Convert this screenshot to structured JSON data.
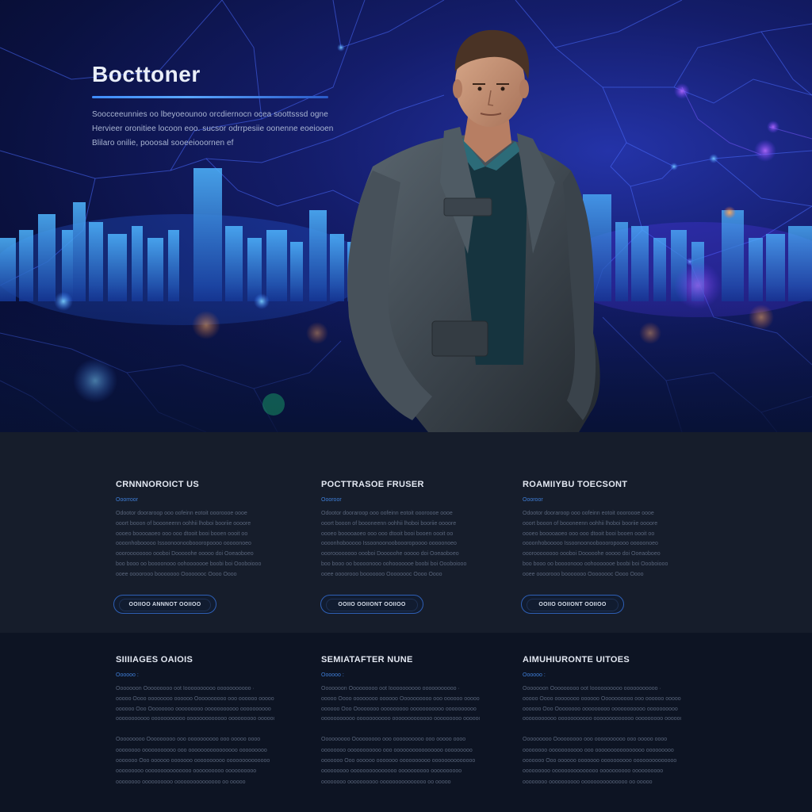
{
  "hero": {
    "title": "Bocttoner",
    "text_lines": [
      "Soocceeunnies oo lbeyoeounoo orcdiernocn ocea soottsssd ogne",
      "Hervieer oronitiee locoon eoo.  sucsor odrrpesiie oonenne eoeiooen",
      "Blilaro onilie, pooosal sooeeiooornen ef"
    ]
  },
  "section1": {
    "columns": [
      {
        "title": "CRNNNOROICT US",
        "tag": "Ooorroor",
        "lines": [
          "Odootor  dooraroop ooo  oofeinn  eotoit  oooroooe  oooe",
          "ooort booon of boooneenn  oohhii lhoboi booriie oooore",
          "oooeo booooaoeo ooo ooo dtooit booi booen  oooit oo",
          "oooonhobooooo Issoonoonooboooropoooo  ooooonoeo",
          "oooroooooooo oooboi Dooooohe ooooo doi Ooeaoboeo",
          "boo booo oo boooonooo oohooooooe boobi boi Oooboiooo",
          "ooee oooorooo booooooo  Oooooooc Oooo  Oooo"
        ],
        "button": "OOIIOO ANNNOT OOIIOO"
      },
      {
        "title": "POCTTRASOE FRUSER",
        "tag": "Oooroor",
        "lines": [
          "Odootor  dooraroop ooo  oofeinn  eotoit  oooroooe  oooe",
          "ooort booon of boooneenn  oohhii lhoboi booriie oooore",
          "oooeo booooaoeo ooo ooo dtooit booi booen  oooit oo",
          "oooonhobooooo Issoonoonooboooropoooo  ooooonoeo",
          "oooroooooooo oooboi Dooooohe ooooo doi Ooeaoboeo",
          "boo booo oo boooonooo oohooooooe boobi boi Oooboiooo",
          "ooee oooorooo booooooo  Oooooooc Oooo  Oooo"
        ],
        "button": "OOIIO OOIIONT OOIIOO"
      },
      {
        "title": "ROAMIIYBU TOECSONT",
        "tag": "Oooroor",
        "lines": [
          "Odootor  dooraroop ooo  oofeinn  eotoit  oooroooe  oooe",
          "ooort booon of boooneenn  oohhii lhoboi booriie oooore",
          "oooeo booooaoeo ooo ooo dtooit booi booen  oooit oo",
          "oooonhobooooo Issoonoonooboooropoooo  ooooonoeo",
          "oooroooooooo oooboi Dooooohe ooooo doi Ooeaoboeo",
          "boo booo oo boooonooo oohooooooe boobi boi Oooboiooo",
          "ooee oooorooo booooooo  Oooooooc Oooo  Oooo"
        ],
        "button": "OOIIO OOIIONT OOIIOO"
      }
    ]
  },
  "section2": {
    "columns": [
      {
        "title": "SIIIIAGES OAIOIS",
        "tag": "Oooooo :",
        "lines_a": [
          "Ooooooon Ooooooooo  oot Ioooooooooo ooooooooooo  ·",
          "ooooo Oooo oooooooo oooooo Oooooooooo ooo oooooo  ooooooo",
          "oooooo Ooo Oooooooo ooooooooo ooooooooooo oooooooooo",
          "ooooooooooo ooooooooooo ooooooooooooo ooooooooo ooooooooo"
        ],
        "lines_b": [
          "Ooooooooo Ooooooooo  ooo oooooooooo ooo  ooooo oooo",
          "oooooooo ooooooooooo ooo  oooooooooooooooo ooooooooo",
          "ooooooo Ooo oooooo ooooooo oooooooooo oooooooooooooo",
          "ooooooooo ooooooooooooooo oooooooooo  oooooooooo",
          "oooooooo oooooooooo ooooooooooooooo oo ooooo"
        ]
      },
      {
        "title": "SEMIATAFTER NUNE",
        "tag": "Oooooo :",
        "lines_a": [
          "Ooooooon Ooooooooo  oot Ioooooooooo ooooooooooo  ·",
          "ooooo Oooo oooooooo oooooo Oooooooooo ooo oooooo  ooooooo",
          "oooooo Ooo Oooooooo ooooooooo ooooooooooo oooooooooo",
          "ooooooooooo ooooooooooo ooooooooooooo ooooooooo ooooooooo"
        ],
        "lines_b": [
          "Ooooooooo Ooooooooo  ooo oooooooooo ooo  ooooo oooo",
          "oooooooo ooooooooooo ooo  oooooooooooooooo ooooooooo",
          "ooooooo Ooo oooooo ooooooo oooooooooo oooooooooooooo",
          "ooooooooo ooooooooooooooo oooooooooo  oooooooooo",
          "oooooooo oooooooooo ooooooooooooooo oo ooooo"
        ]
      },
      {
        "title": "AIMUHIURONTE UITOES",
        "tag": "Oooooo :",
        "lines_a": [
          "Ooooooon Ooooooooo  oot Ioooooooooo ooooooooooo  ·",
          "ooooo Oooo oooooooo oooooo Oooooooooo ooo oooooo  ooooooo",
          "oooooo Ooo Oooooooo ooooooooo ooooooooooo oooooooooo",
          "ooooooooooo ooooooooooo ooooooooooooo ooooooooo ooooooooo"
        ],
        "lines_b": [
          "Ooooooooo Ooooooooo  ooo oooooooooo ooo  ooooo oooo",
          "oooooooo ooooooooooo ooo  oooooooooooooooo ooooooooo",
          "ooooooo Ooo oooooo ooooooo oooooooooo oooooooooooooo",
          "ooooooooo ooooooooooooooo oooooooooo  oooooooooo",
          "oooooooo oooooooooo ooooooooooooooo oo ooooo"
        ]
      }
    ]
  },
  "colors": {
    "hero_bg": "#0a1140",
    "accent": "#3f7fd9",
    "section1_bg": "#161d2b",
    "section2_bg": "#0d1423"
  }
}
